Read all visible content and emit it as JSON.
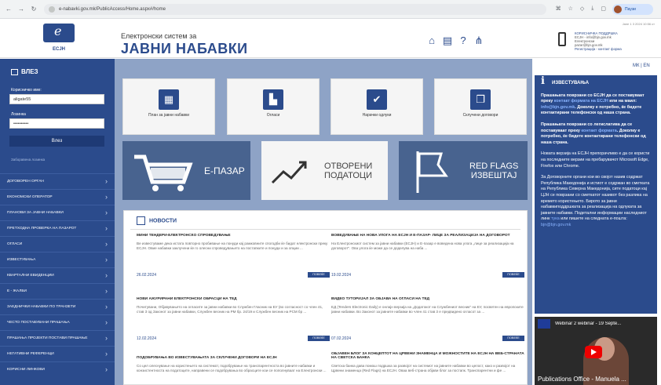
{
  "browser": {
    "url": "e-nabavki.gov.mk/PublicAccess/Home.aspx#/home",
    "profile": "Паузи"
  },
  "header": {
    "logo_text": "ЕСЈН",
    "subtitle": "Електронски систем за",
    "title": "ЈАВНИ НАБАВКИ",
    "timestamp": "Jane 1 3 2024 10:56 ст",
    "contact": {
      "title": "КОРИСНИЧКА ПОДДРШКА",
      "email1": "ЕСЈН - info@bjn.gov.mk",
      "l2": "Електронски",
      "email2": "pazar@bjn.gov.mk",
      "l3": "Регистрација - контакт форма"
    }
  },
  "login": {
    "title": "ВЛЕЗ",
    "username_label": "Корисничко име:",
    "username_value": "aligate55",
    "password_label": "Лозинка",
    "password_value": "••••••••••",
    "button": "Влез",
    "forgot": "Заборавена лозинка"
  },
  "menu": [
    "ДОГОВОРЕН ОРГАН",
    "ЕКОНОМСКИ ОПЕРАТОР",
    "ПЛАНОВИ ЗА ЈАВНИ НАБАВКИ",
    "ПРЕТХОДНА ПРОВЕРКА НА ПАЗАРОТ",
    "ОГЛАСИ",
    "ИЗВЕСТУВАЊА",
    "КВАРТАЛНИ ЕВИДЕНЦИИ",
    "Е - ЖАЛБИ",
    "ЗАЕДНИЧКИ НАБАВКИ ПО ТРАНЗЕТИ",
    "ЧЕСТО ПОСТАВУВАНИ ПРАШАЊА",
    "ПРАШАЊА ПРОЈЕКТИ ПОСТАВИ ПРАШАЊЕ",
    "НЕГАТИВНИ РЕФЕРЕНЦИ",
    "КОРИСНИ ЛИНКОВИ"
  ],
  "tiles": [
    {
      "label": "План за јавни набавки",
      "icon": "calendar-icon"
    },
    {
      "label": "Огласи",
      "icon": "document-icon"
    },
    {
      "label": "Нарачки одлуки",
      "icon": "folder-check-icon"
    },
    {
      "label": "Склучени договори",
      "icon": "contract-icon"
    }
  ],
  "banners": {
    "epazar": "Е-ПАЗАР",
    "open1": "ОТВОРЕНИ",
    "open2": "ПОДАТОЦИ",
    "red1": "RED FLAGS",
    "red2": "ИЗВЕШТАЈ"
  },
  "news": {
    "title": "НОВОСТИ",
    "more": "ПОВЕЌЕ",
    "items": [
      {
        "title": "МИНИ ТЕНДЕРИ-ЕЛЕКТРОНСКО СПРОВЕДУВАЊЕ",
        "text": "Ве известуваме дека истата повторно пробивање на понуди кај рамковните спогодби ќе бидат електронски преку ЕСЈН. Овие набавки заклучени ќе го олесни спроведувањето на постапките и понуди и за опции ...",
        "date": "26.02.2024"
      },
      {
        "title": "ВОВЕДУВАЊЕ НА НОВА УЛОГА НА ЕСЈН И Е-ПАЗАР- ЛИЦЕ ЗА РЕАЛИЗАЦИЈА НА ДОГОВОРОТ",
        "text": "На Електронскиот систем за јавни набавки (ЕСЈН) и Е-пазар е воведена нова улога „лице за реализација на договорот\". Ова улога ќе може да се доделува на наба ...",
        "date": "19.02.2024"
      },
      {
        "title": "НОВИ АЖУРИРАНИ ЕЛЕКТРОНСКИ ОБРАСЦИ НА ТЕД",
        "text": "Почитувани, Објавувањето на огласите за јавни набавки во Службен Гласник на ЕУ (во согласност со член 41, став 3 од Законот за јавни набавки, Службен весник на РМ бр. 24/19 и Службен весник на РСМ бр ...",
        "date": "12.02.2024"
      },
      {
        "title": "ВИДЕО ТУТОРИЈАЛ ЗА ОБЈАВА НА ОГЛАСИ НА ТЕД",
        "text": "ЕД (Tenders Electronic Daily) е онлајн верзија на „Додатокот на Службениот весник\" на ЕУ, посветен на европските јавни набавки. Во Законот за јавните набавки во член 41 став 3 е предвидено огласот за ...",
        "date": "07.02.2024"
      },
      {
        "title": "ПОДОБРУВАЊА ВО ИЗВЕСТУВАЊАТА ЗА СКЛУЧЕНИ ДОГОВОРИ НА ЕСЈН",
        "text": "Со цел олеснување на користењето на системот, подобрување на транспарентноста во јавните набавки и конзистентноста на податоците, направени се подобрувања во обрасците кои се пополнуваат на Електронски ...",
        "date": ""
      },
      {
        "title": "ОБЈАВЕН БЛОГ ЗА КОНЦЕПТОТ НА ЦРВЕНИ ЗНАМЕНЦА И МОЖНОСТИТЕ НА ЕСЈН НА ВЕБ-СТРАНАТА НА СВЕТСКА БАНКА",
        "text": "Светска банка дава помош подршка за развојот на системот на јавните набавки во целост, како и развојот на Црвени знаменца (Red Flags) на ЕСЈН. Оваа веб-страна објави блог за постапк. Транспарентни и фе ...",
        "date": ""
      }
    ]
  },
  "lang": "МК | EN",
  "notice": {
    "title": "ИЗВЕСТУВАЊА",
    "p1a": "Прашањата поврзани со ЕСЈН да се поставуваат преку ",
    "p1link": "контакт формата на ЕСЈН",
    "p1b": " или на маил: ",
    "p1mail": "info@bjn.gov.mk",
    "p1c": ". Доколку е потребно, ќе бидете контактирани телефонски од наша страна.",
    "p2a": "Прашањата поврзани со легислатива да се поставуваат преку ",
    "p2link": "контакт формата",
    "p2b": ". Доколку е потребно, ќе бидете контактирани телефонски од наша страна.",
    "p3": "Новата верзија на ЕСЈН препорачливо е да се користи на последните верзии на пребарувачот Microsoft Edge, Firefox или Chrome.",
    "p4a": "За Договорните органи кои во својот назив содржат Република Македонија и истиот е содржан во сметката на Република Северна Македонија, сите податоци кај ЦЈН се поврзани со сметкатот називот без разлика на времето користењето. Бирото за јавни набавкиподдршката за реализација на одлуката за јавните набавки. Подетални информации наследниот линк ",
    "p4link": "тука",
    "p4b": " или пишете на следната е-пошта: ",
    "p4mail": "bjn@bjn.gov.mk"
  },
  "video": {
    "title": "Webinar 2 webinar - 19 Septe...",
    "bottom": "Publications Office - Manuela ..."
  }
}
